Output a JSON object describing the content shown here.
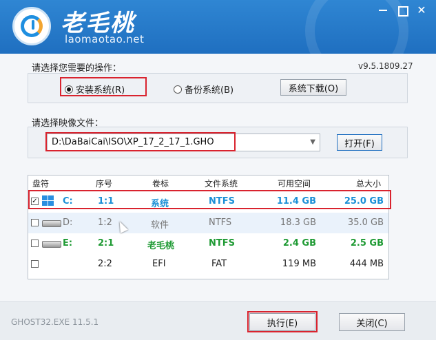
{
  "app": {
    "title": "老毛桃",
    "url": "laomaotao.net",
    "version": "v9.5.1809.27"
  },
  "operation": {
    "label": "请选择您需要的操作：",
    "install_label": "安装系统(R)",
    "backup_label": "备份系统(B)",
    "download_label": "系统下载(O)"
  },
  "image": {
    "label": "请选择映像文件：",
    "path": "D:\\DaBaiCai\\ISO\\XP_17_2_17_1.GHO",
    "open_label": "打开(F)"
  },
  "table": {
    "headers": [
      "盘符",
      "序号",
      "卷标",
      "文件系统",
      "可用空间",
      "总大小"
    ],
    "rows": [
      {
        "check": "☑",
        "drive": "C:",
        "index": "1:1",
        "label": "系统",
        "fs": "NTFS",
        "free": "11.4 GB",
        "total": "25.0 GB"
      },
      {
        "check": "☐",
        "drive": "D:",
        "index": "1:2",
        "label": "软件",
        "fs": "NTFS",
        "free": "18.3 GB",
        "total": "35.0 GB"
      },
      {
        "check": "☐",
        "drive": "E:",
        "index": "2:1",
        "label": "老毛桃",
        "fs": "NTFS",
        "free": "2.4 GB",
        "total": "2.5 GB"
      },
      {
        "check": "☐",
        "drive": "",
        "index": "2:2",
        "label": "EFI",
        "fs": "FAT",
        "free": "119 MB",
        "total": "444 MB"
      }
    ]
  },
  "footer": {
    "engine": "GHOST32.EXE 11.5.1",
    "execute_label": "执行(E)",
    "close_label": "关闭(C)"
  },
  "colors": {
    "header_blue": "#2f86d3",
    "highlight_red": "#d9232e",
    "c_drive_blue": "#1a8fd6",
    "e_drive_green": "#1e9a33"
  }
}
